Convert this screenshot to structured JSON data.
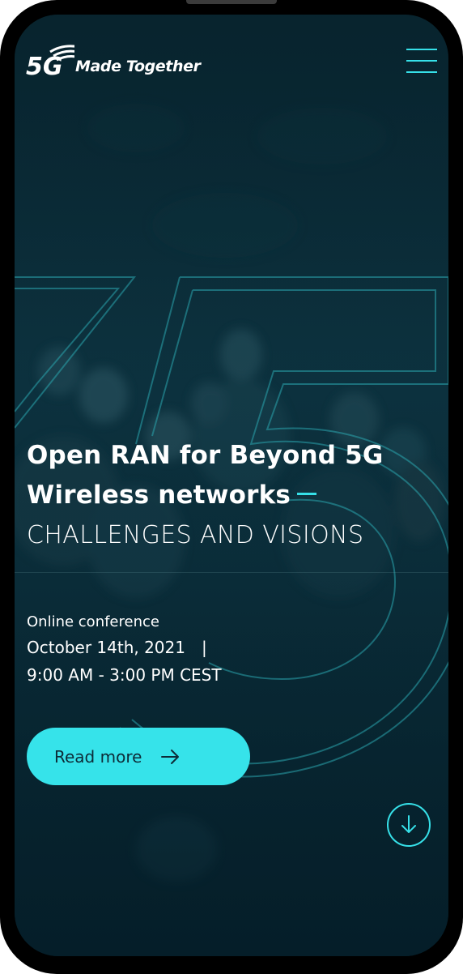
{
  "header": {
    "logo_mark": "5G",
    "logo_text": "Made Together",
    "menu_icon": "hamburger-icon"
  },
  "hero": {
    "title_line1": "Open RAN for Beyond 5G",
    "title_line2": "Wireless networks",
    "subtitle": "CHALLENGES AND VISIONS",
    "background_numeral": "5"
  },
  "event": {
    "kind": "Online conference",
    "date": "October 14th, 2021",
    "separator": "|",
    "time": "9:00 AM - 3:00 PM CEST"
  },
  "cta": {
    "label": "Read more",
    "icon": "arrow-right-icon"
  },
  "scroll": {
    "icon": "arrow-down-icon"
  },
  "colors": {
    "accent": "#36e3ea",
    "background": "#0b2f3b",
    "text": "#ffffff",
    "button_text": "#0d2c38"
  }
}
